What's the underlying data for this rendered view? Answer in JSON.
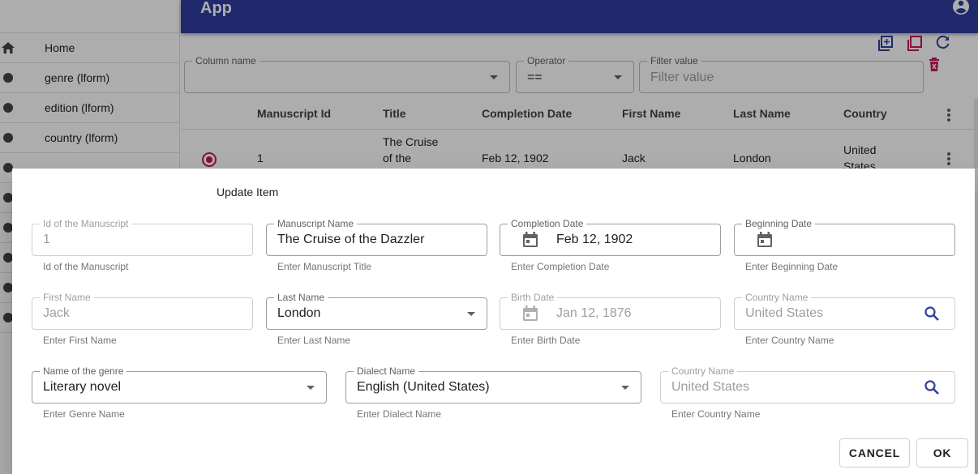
{
  "appbar": {
    "title": "App"
  },
  "sidebar": {
    "items": [
      {
        "label": "Home",
        "icon": "home-icon"
      },
      {
        "label": "genre (lform)",
        "icon": "dot-icon"
      },
      {
        "label": "edition (lform)",
        "icon": "dot-icon"
      },
      {
        "label": "country (lform)",
        "icon": "dot-icon"
      }
    ]
  },
  "filters": {
    "column_name": {
      "label": "Column name",
      "value": ""
    },
    "operator": {
      "label": "Operator",
      "value": "=="
    },
    "filter_value": {
      "label": "Filter value",
      "placeholder": "Filter value"
    }
  },
  "table": {
    "columns": [
      "Manuscript Id",
      "Title",
      "Completion Date",
      "First Name",
      "Last Name",
      "Country"
    ],
    "rows": [
      {
        "id": "1",
        "title_line1": "The Cruise",
        "title_line2": "of the",
        "completion_date": "Feb 12, 1902",
        "first_name": "Jack",
        "last_name": "London",
        "country_line1": "United",
        "country_line2": "States"
      }
    ]
  },
  "dialog": {
    "title": "Update Item",
    "fields": {
      "manuscript_id": {
        "label": "Id of the Manuscript",
        "value": "1",
        "hint": "Id of the Manuscript"
      },
      "manuscript_name": {
        "label": "Manuscript Name",
        "value": "The Cruise of the Dazzler",
        "hint": "Enter Manuscript Title"
      },
      "completion_date": {
        "label": "Completion Date",
        "value": "Feb 12, 1902",
        "hint": "Enter Completion Date"
      },
      "beginning_date": {
        "label": "Beginning Date",
        "value": "",
        "hint": "Enter Beginning Date"
      },
      "first_name": {
        "label": "First Name",
        "value": "Jack",
        "hint": "Enter First Name"
      },
      "last_name": {
        "label": "Last Name",
        "value": "London",
        "hint": "Enter Last Name"
      },
      "birth_date": {
        "label": "Birth Date",
        "value": "Jan 12, 1876",
        "hint": "Enter Birth Date"
      },
      "country_name_1": {
        "label": "Country Name",
        "value": "United States",
        "hint": "Enter Country Name"
      },
      "genre_name": {
        "label": "Name of the genre",
        "value": "Literary novel",
        "hint": "Enter Genre Name"
      },
      "dialect_name": {
        "label": "Dialect Name",
        "value": "English (United States)",
        "hint": "Enter Dialect Name"
      },
      "country_name_2": {
        "label": "Country Name",
        "value": "United States",
        "hint": "Enter Country Name"
      }
    },
    "buttons": {
      "cancel": "CANCEL",
      "ok": "OK"
    }
  },
  "colors": {
    "primary": "#2f3d9f",
    "accent": "#c2185b"
  }
}
